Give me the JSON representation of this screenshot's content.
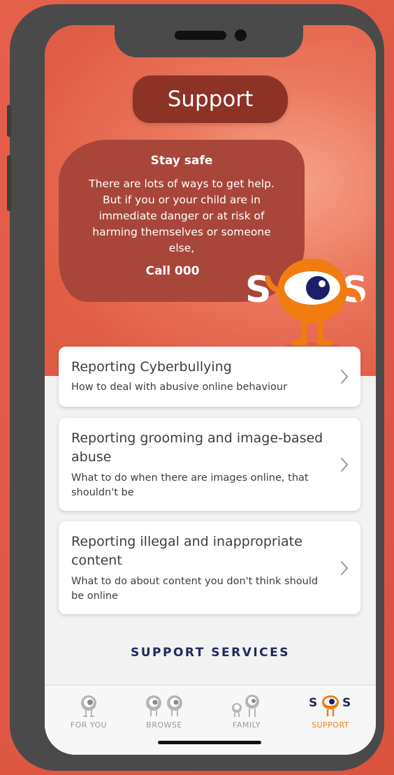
{
  "header": {
    "title": "Support"
  },
  "safety": {
    "title": "Stay safe",
    "text": "There are lots of ways to get help. But if you or your child are in immediate danger or at risk of harming themselves or someone else,",
    "call": "Call 000"
  },
  "mascot": {
    "letter_left": "S",
    "letter_right": "S"
  },
  "cards": [
    {
      "title": "Reporting Cyberbullying",
      "subtitle": "How to deal with abusive online behaviour"
    },
    {
      "title": "Reporting grooming and image-based abuse",
      "subtitle": "What to do when there are images online, that shouldn't be"
    },
    {
      "title": "Reporting illegal and inappropriate content",
      "subtitle": "What to do about content you don't think should be online"
    }
  ],
  "support_services": "SUPPORT SERVICES",
  "tabs": [
    {
      "label": "FOR YOU",
      "icon": "eye-character-icon",
      "active": false
    },
    {
      "label": "BROWSE",
      "icon": "glasses-characters-icon",
      "active": false
    },
    {
      "label": "FAMILY",
      "icon": "family-characters-icon",
      "active": false
    },
    {
      "label": "SUPPORT",
      "icon": "sos-icon",
      "active": true
    }
  ],
  "colors": {
    "background": "#dd5a43",
    "title_pill": "#8c3326",
    "safety_blob": "#a9463a",
    "accent_orange": "#f07c12",
    "support_services": "#23275f"
  }
}
